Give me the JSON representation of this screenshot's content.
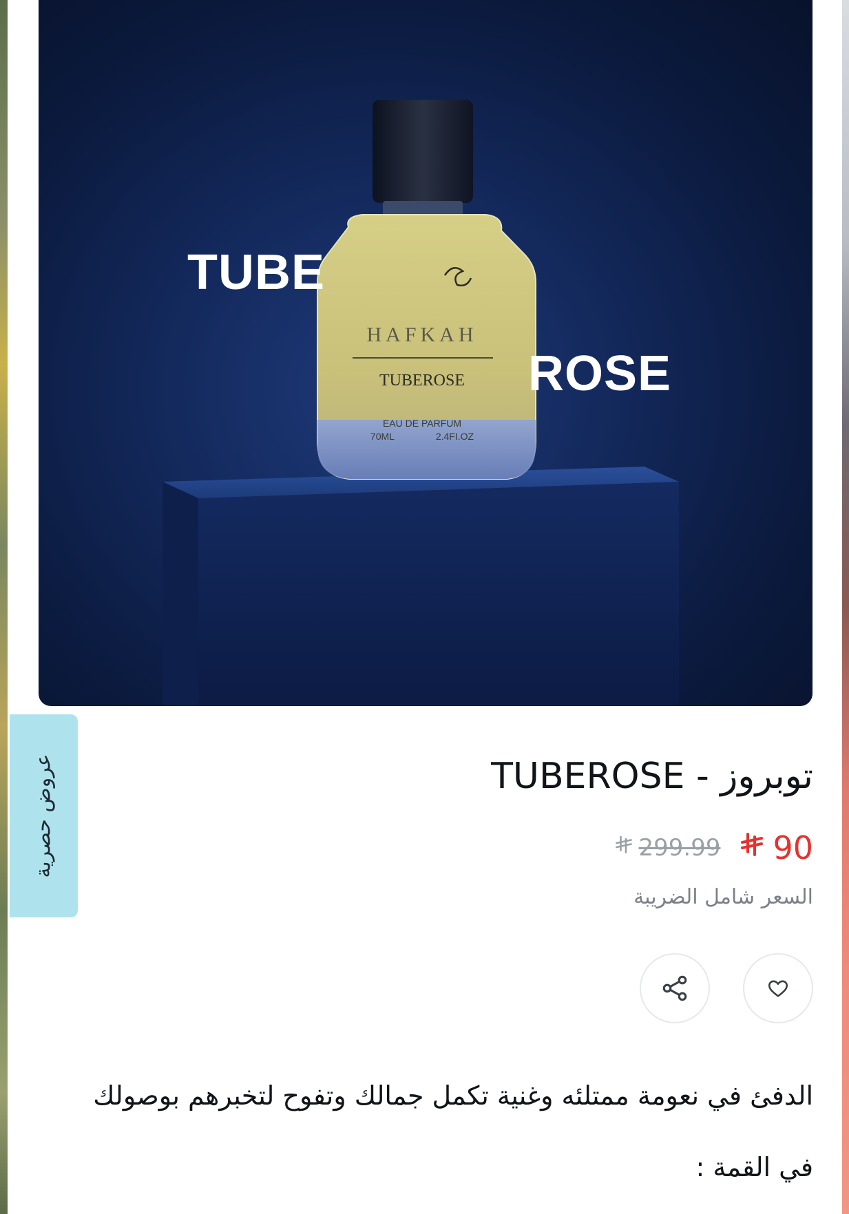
{
  "hero": {
    "word_left": "TUBE",
    "word_right": "ROSE",
    "bottle_brand": "HAFKAH",
    "bottle_name": "TUBEROSE",
    "bottle_type": "EAU DE PARFUM",
    "bottle_ml": "70ML",
    "bottle_oz": "2.4FI.OZ"
  },
  "side_tab": {
    "label": "عروض حصرية"
  },
  "product": {
    "title": "توبروز - TUBEROSE",
    "price_new": "90",
    "price_old": "299.99",
    "currency_symbol": "⃁",
    "tax_note": "السعر شامل الضريبة",
    "description_line1": "الدفئ في نعومة ممتلئه وغنية تكمل جمالك وتفوح لتخبرهم بوصولك",
    "description_line2": "في القمة :"
  },
  "icons": {
    "wishlist": "heart-icon",
    "share": "share-icon",
    "currency": "riyal-icon"
  },
  "colors": {
    "price_new": "#e4332f",
    "price_old": "#9aa0a6",
    "side_tab_bg": "#aee3ee",
    "hero_bg": "#0b1a3e"
  }
}
